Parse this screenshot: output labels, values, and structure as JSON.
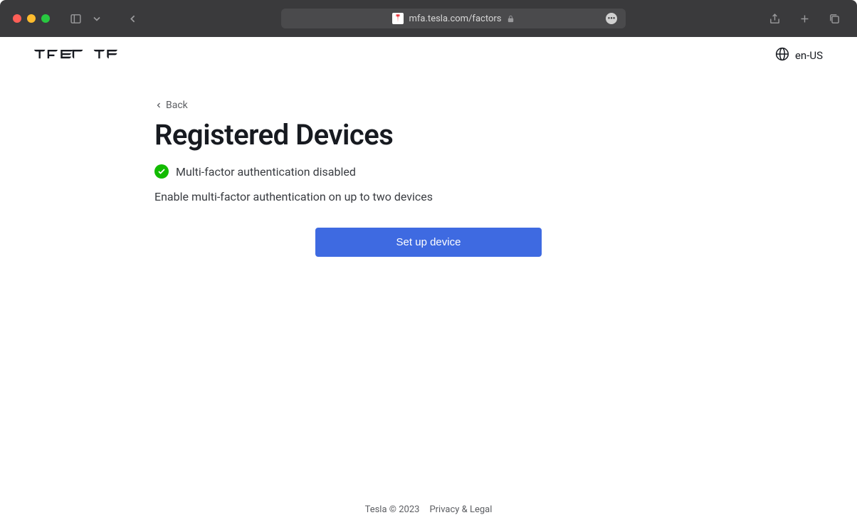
{
  "browser": {
    "url": "mfa.tesla.com/factors"
  },
  "header": {
    "logo": "T E S L A",
    "locale": "en-US"
  },
  "main": {
    "back_label": "Back",
    "title": "Registered Devices",
    "status_text": "Multi-factor authentication disabled",
    "description": "Enable multi-factor authentication on up to two devices",
    "button_label": "Set up device"
  },
  "footer": {
    "copyright": "Tesla © 2023",
    "legal": "Privacy & Legal"
  }
}
